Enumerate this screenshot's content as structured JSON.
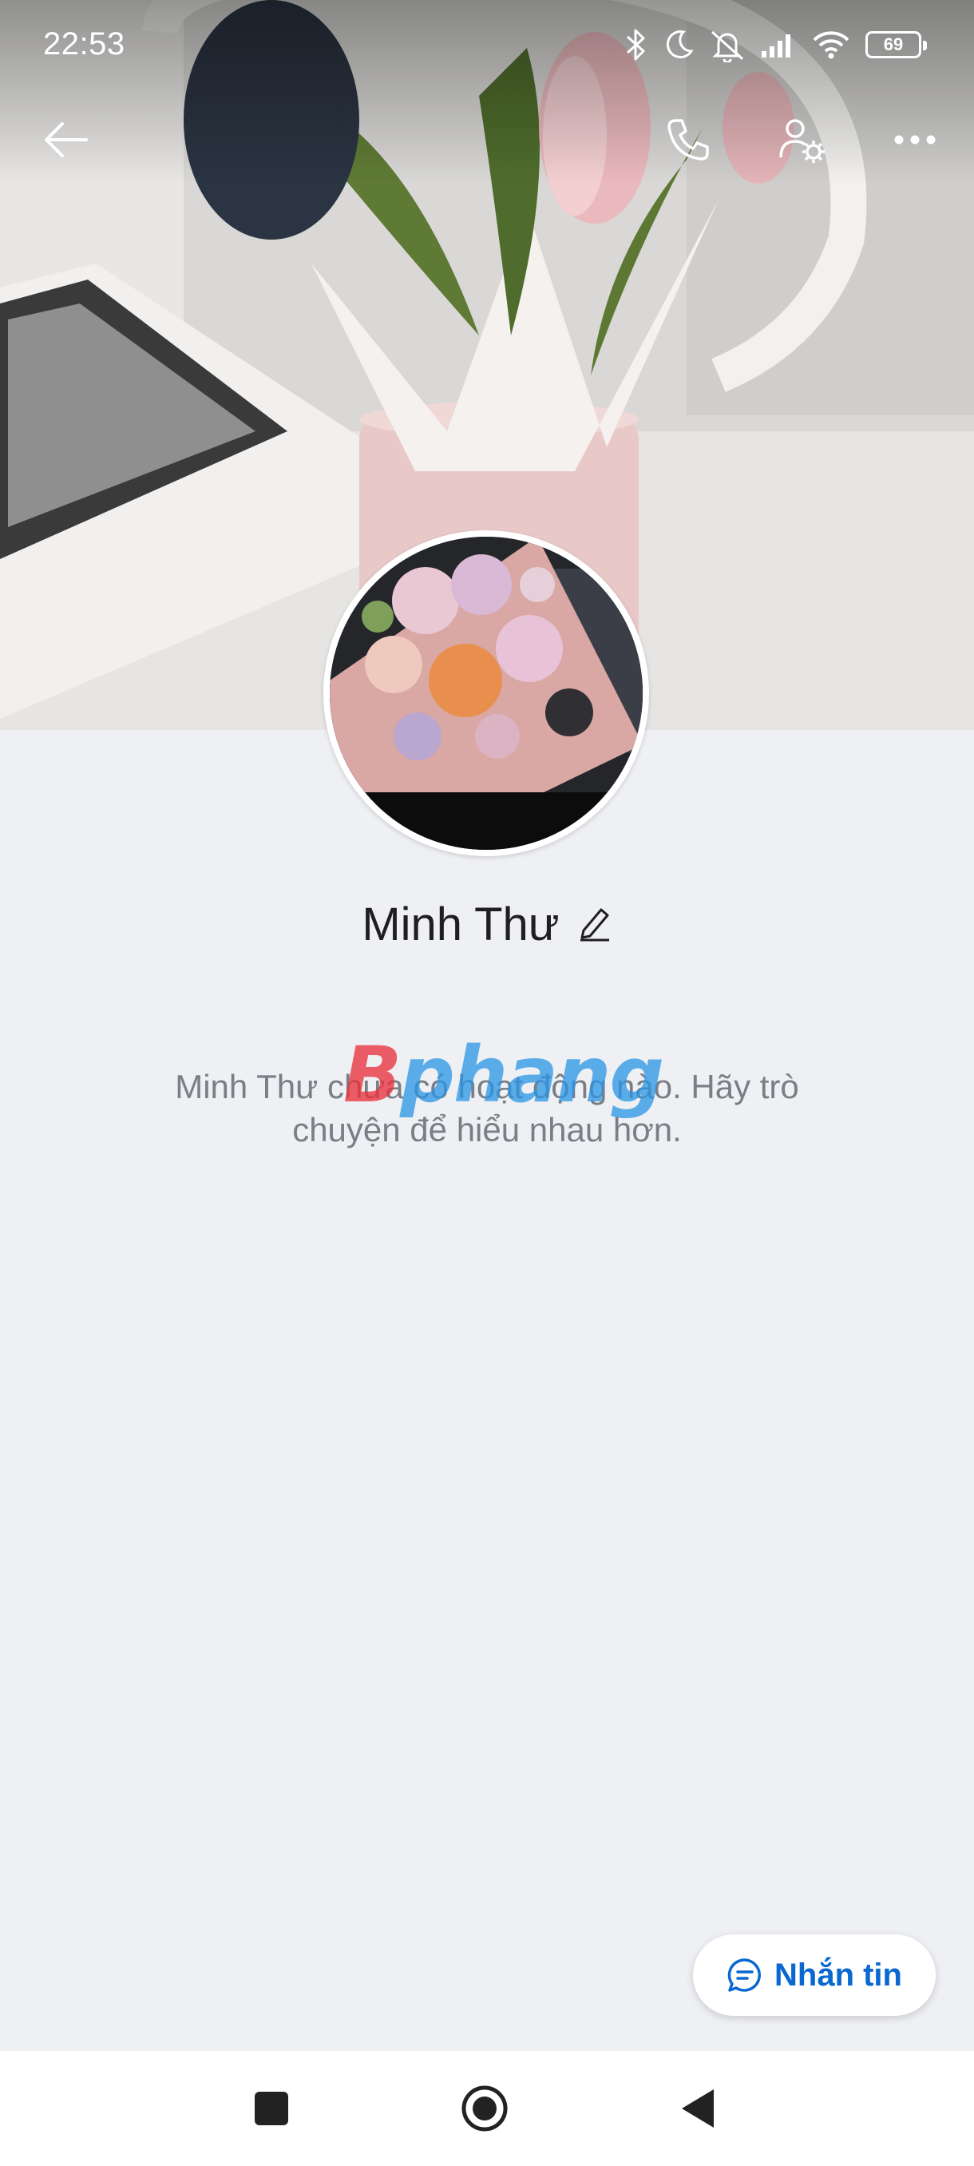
{
  "status_bar": {
    "time": "22:53",
    "battery": "69",
    "icons": [
      "bluetooth-icon",
      "moon-icon",
      "silent-bell-icon",
      "signal-icon",
      "wifi-icon",
      "battery-icon"
    ]
  },
  "header": {
    "icons": [
      "back-arrow-icon",
      "phone-icon",
      "user-settings-icon",
      "more-icon"
    ]
  },
  "profile": {
    "name": "Minh Thư",
    "empty_message": "Minh Thư chưa có hoạt động nào. Hãy trò chuyện để hiểu nhau hơn."
  },
  "watermark": {
    "part1": "B",
    "part2": "phang"
  },
  "actions": {
    "message_label": "Nhắn tin"
  },
  "colors": {
    "accent": "#0a68d0",
    "background": "#eff0f4",
    "text_secondary": "#7a7e85"
  },
  "nav": {
    "icons": [
      "recent-apps-icon",
      "home-icon",
      "back-icon"
    ]
  }
}
